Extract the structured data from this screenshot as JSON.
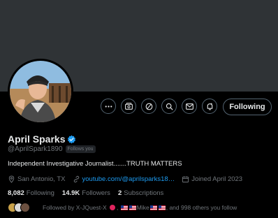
{
  "profile": {
    "name": "April Sparks",
    "handle": "@AprilSpark1890",
    "follows_you": "Follows you",
    "bio": "Independent Investigative Journalist.......TRUTH MATTERS"
  },
  "meta": {
    "location": "San Antonio, TX",
    "link": "youtube.com/@aprilsparks18…",
    "joined": "Joined April 2023"
  },
  "stats": {
    "following_count": "8,082",
    "following_label": "Following",
    "followers_count": "14.9K",
    "followers_label": "Followers",
    "subscriptions_count": "2",
    "subscriptions_label": "Subscriptions"
  },
  "actions": {
    "follow_label": "Following",
    "icons": [
      "more-icon",
      "subscribe-icon",
      "grok-icon",
      "search-icon",
      "message-icon",
      "notify-icon"
    ]
  },
  "followed_by": {
    "prefix": "Followed by X-JQuest-X",
    "mid": "Mike",
    "suffix": ", and 998 others you follow"
  },
  "colors": {
    "background": "#000000",
    "banner": "#2f3336",
    "accent": "#1d9bf0",
    "muted": "#71767b",
    "text": "#e7e9ea"
  }
}
